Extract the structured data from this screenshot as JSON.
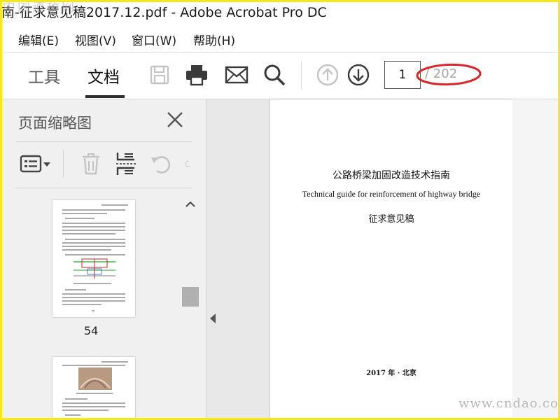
{
  "window": {
    "title": "南-征求意见稿2017.12.pdf - Adobe Acrobat Pro DC",
    "watermark_top_left": "中国道桥网"
  },
  "menu": {
    "items": [
      "编辑(E)",
      "视图(V)",
      "窗口(W)",
      "帮助(H)"
    ]
  },
  "toolbar": {
    "tabs": [
      "工具",
      "文档"
    ],
    "active_tab": "文档",
    "icons": [
      "save-icon",
      "print-icon",
      "email-icon",
      "search-icon",
      "previous-page-icon",
      "next-page-icon"
    ],
    "current_page": "1",
    "total_pages": "/ 202",
    "highlight_color": "#d9262b"
  },
  "sidebar": {
    "title": "页面缩略图",
    "tools": [
      "thumbnail-options-icon",
      "delete-icon",
      "extract-pages-icon",
      "undo-icon"
    ],
    "thumbnails": [
      {
        "label": "54"
      }
    ]
  },
  "document": {
    "title_cn": "公路桥梁加固改造技术指南",
    "title_en": "Technical guide for reinforcement of highway bridge",
    "subtitle": "征求意见稿",
    "date_line": "2017 年 · 北京"
  },
  "watermark_bottom_right": "www.cndao.com"
}
